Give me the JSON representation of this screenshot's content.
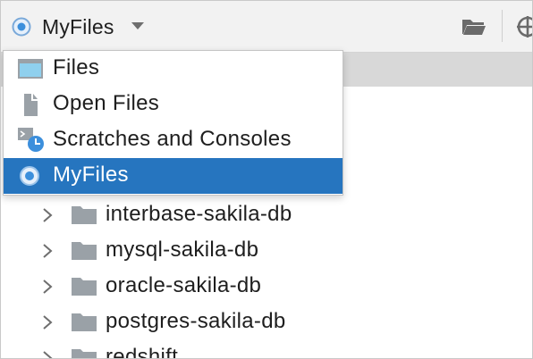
{
  "toolbar": {
    "view_title": "MyFiles"
  },
  "popup": {
    "items": [
      {
        "label": "Files",
        "icon": "files-window-icon"
      },
      {
        "label": "Open Files",
        "icon": "open-file-icon"
      },
      {
        "label": "Scratches and Consoles",
        "icon": "scratches-icon"
      },
      {
        "label": "MyFiles",
        "icon": "scope-radio-icon",
        "selected": true
      }
    ]
  },
  "tree": {
    "items": [
      {
        "label": "interbase-sakila-db"
      },
      {
        "label": "mysql-sakila-db"
      },
      {
        "label": "oracle-sakila-db"
      },
      {
        "label": "postgres-sakila-db"
      },
      {
        "label": "redshift"
      }
    ]
  },
  "colors": {
    "selection": "#2675bf",
    "accent": "#3c8fdc",
    "folder": "#9aa1a7"
  }
}
